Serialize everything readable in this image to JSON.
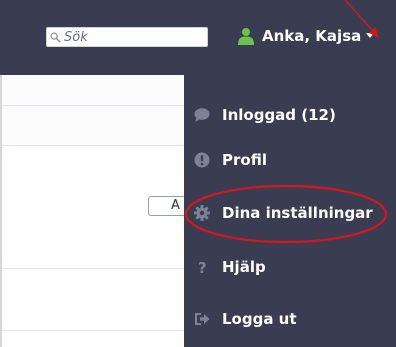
{
  "navbar": {
    "search": {
      "placeholder": "Sök",
      "value": ""
    },
    "user": {
      "name": "Anka, Kajsa"
    }
  },
  "page": {
    "partial_button_label": "A"
  },
  "dropdown": {
    "items": [
      {
        "label": "Inloggad (12)",
        "icon": "comment-icon"
      },
      {
        "label": "Profil",
        "icon": "exclamation-circle-icon"
      },
      {
        "label": "Dina inställningar",
        "icon": "gear-icon"
      },
      {
        "label": "Hjälp",
        "icon": "question-icon"
      },
      {
        "label": "Logga ut",
        "icon": "logout-icon"
      }
    ]
  },
  "colors": {
    "navbar_bg": "#3a3d52",
    "user_icon": "#6cc24a",
    "menu_icon": "#7d8296",
    "annotation": "#d8141d"
  }
}
